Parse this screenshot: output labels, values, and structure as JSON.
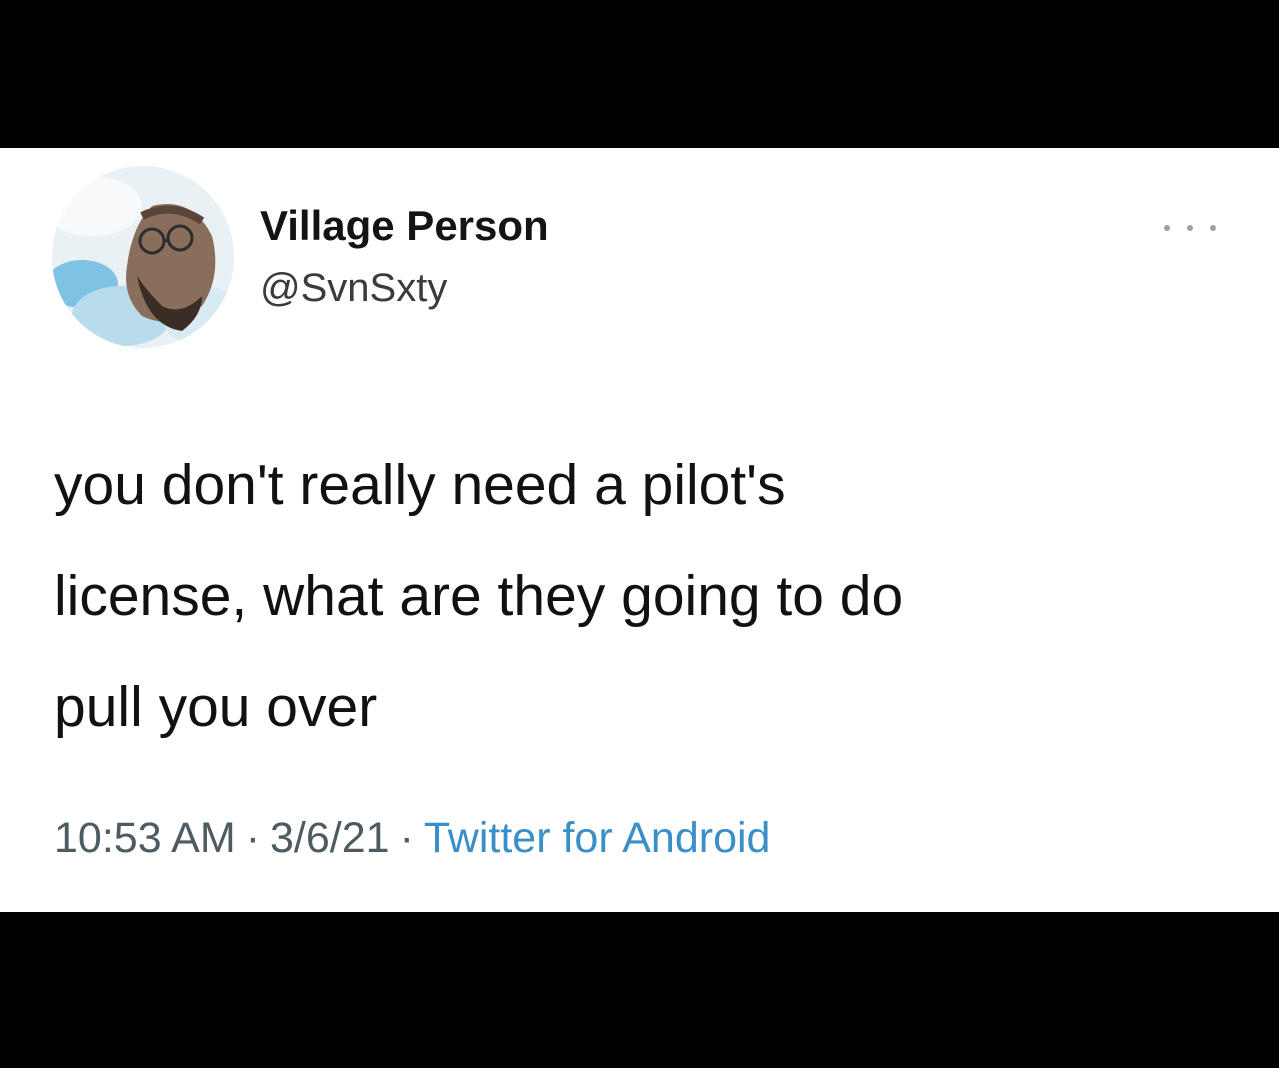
{
  "tweet": {
    "author": {
      "display_name": "Village Person",
      "handle": "@SvnSxty",
      "avatar_icon": "profile-photo"
    },
    "more_icon": "more-options-icon",
    "text": "you don't really need a pilot's\nlicense, what are they going to do\npull you over",
    "time": "10:53 AM",
    "date": "3/6/21",
    "separator": "·",
    "source": "Twitter for Android"
  },
  "colors": {
    "frame": "#000000",
    "card": "#ffffff",
    "text": "#111111",
    "meta_text": "#4e5b63",
    "source_link": "#3a8fc9"
  }
}
